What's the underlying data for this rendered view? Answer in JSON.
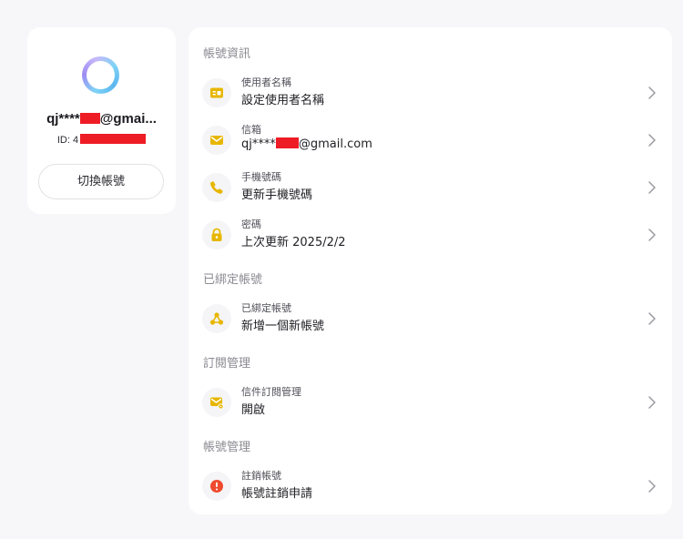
{
  "profile": {
    "name_prefix": "qj****",
    "name_suffix": "@gmai...",
    "id_prefix": "ID: 4",
    "switch_account_label": "切換帳號"
  },
  "sections": {
    "account_info": {
      "title": "帳號資訊",
      "username": {
        "label": "使用者名稱",
        "value": "設定使用者名稱",
        "icon": "id-card-icon"
      },
      "email": {
        "label": "信箱",
        "value_prefix": "qj****",
        "value_suffix": "@gmail.com",
        "icon": "envelope-icon"
      },
      "phone": {
        "label": "手機號碼",
        "value": "更新手機號碼",
        "icon": "phone-icon"
      },
      "password": {
        "label": "密碼",
        "value": "上次更新 2025/2/2",
        "icon": "lock-icon"
      }
    },
    "linked_accounts": {
      "title": "已綁定帳號",
      "linked": {
        "label": "已綁定帳號",
        "value": "新增一個新帳號",
        "icon": "link-nodes-icon"
      }
    },
    "subscription": {
      "title": "訂閱管理",
      "mail_subscription": {
        "label": "信件訂閱管理",
        "value": "開啟",
        "icon": "mail-settings-icon"
      }
    },
    "account_management": {
      "title": "帳號管理",
      "deactivate": {
        "label": "註銷帳號",
        "value": "帳號註銷申請",
        "icon": "warning-icon"
      }
    }
  },
  "colors": {
    "accent_icon": "#e7b600",
    "danger_icon": "#ef4a2e",
    "redaction": "#ee1c25",
    "section_title": "#8a8a92",
    "background": "#f7f7f9",
    "card": "#ffffff"
  }
}
